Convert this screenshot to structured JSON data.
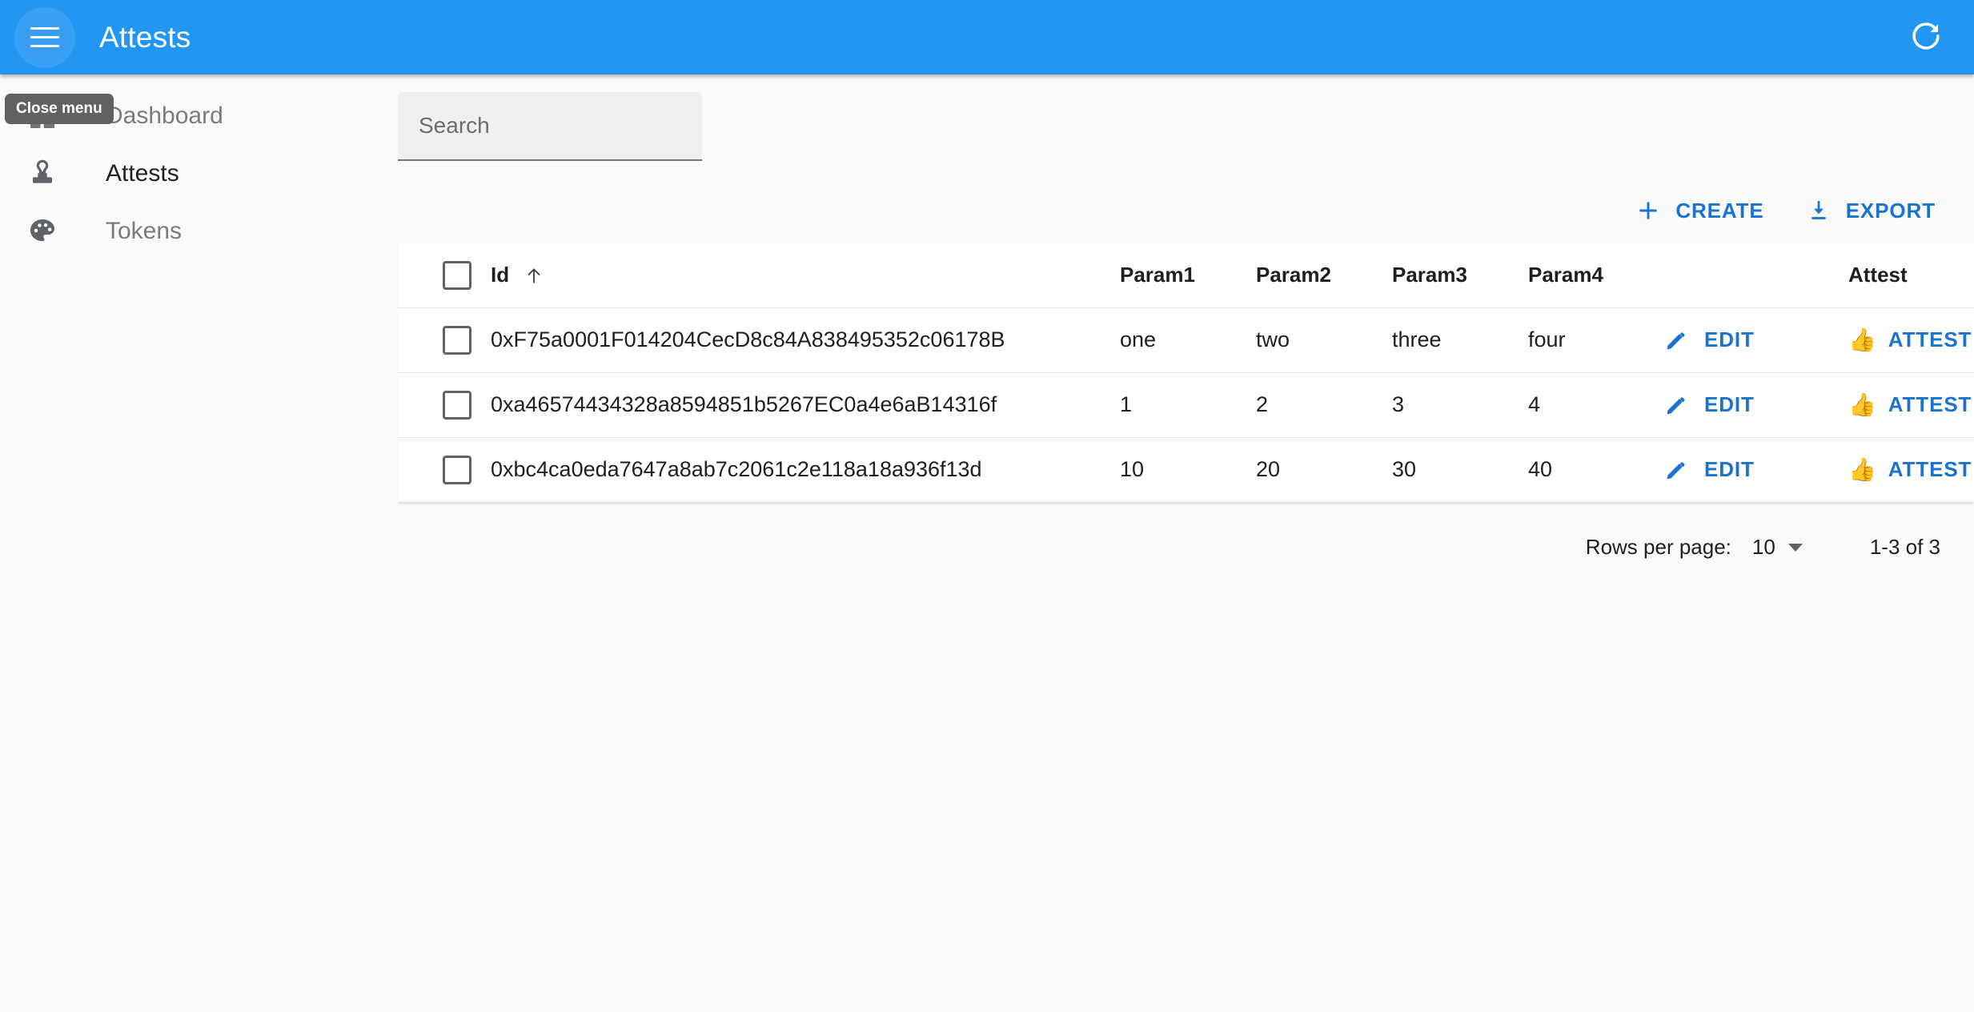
{
  "appbar": {
    "title": "Attests",
    "menu_icon": "hamburger-menu-icon",
    "refresh_icon": "refresh-icon"
  },
  "tooltip": {
    "text": "Close menu"
  },
  "sidebar": {
    "items": [
      {
        "label": "Dashboard",
        "icon": "dashboard-icon",
        "active": false
      },
      {
        "label": "Attests",
        "icon": "stamp-icon",
        "active": true
      },
      {
        "label": "Tokens",
        "icon": "palette-icon",
        "active": false
      }
    ]
  },
  "search": {
    "value": "",
    "placeholder": "Search"
  },
  "toolbar": {
    "create_label": "CREATE",
    "export_label": "EXPORT",
    "create_icon": "plus-icon",
    "export_icon": "download-icon"
  },
  "table": {
    "headers": {
      "id": "Id",
      "param1": "Param1",
      "param2": "Param2",
      "param3": "Param3",
      "param4": "Param4",
      "edit": "",
      "attest": "Attest"
    },
    "sort": {
      "column": "Id",
      "direction": "asc",
      "icon": "arrow-up-icon"
    },
    "edit_label": "EDIT",
    "attest_label": "ATTEST",
    "edit_icon": "pencil-icon",
    "attest_icon": "thumbs-up-emoji",
    "rows": [
      {
        "id": "0xF75a0001F014204CecD8c84A838495352c06178B",
        "param1": "one",
        "param2": "two",
        "param3": "three",
        "param4": "four",
        "checked": false
      },
      {
        "id": "0xa46574434328a8594851b5267EC0a4e6aB14316f",
        "param1": "1",
        "param2": "2",
        "param3": "3",
        "param4": "4",
        "checked": false
      },
      {
        "id": "0xbc4ca0eda7647a8ab7c2061c2e118a18a936f13d",
        "param1": "10",
        "param2": "20",
        "param3": "30",
        "param4": "40",
        "checked": false
      }
    ]
  },
  "pagination": {
    "rows_per_page_label": "Rows per page:",
    "rows_per_page_value": "10",
    "range_label": "1-3 of 3"
  },
  "colors": {
    "primary": "#2196f3",
    "link": "#1a73d0",
    "page_bg": "#fafafa",
    "card_bg": "#ffffff",
    "tooltip_bg": "#616161"
  }
}
